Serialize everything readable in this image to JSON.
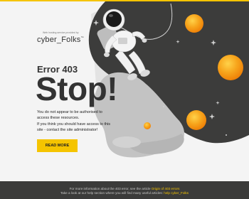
{
  "brand": {
    "tagline": "Web hosting service provided by",
    "name": "cyber_Folks",
    "trademark": "™"
  },
  "error": {
    "code_label": "Error 403",
    "headline": "Stop!",
    "message_line1": "You do not appear to be authorised to access these resources.",
    "message_line2": "If you think you should have access to this site - contact the site administrator!"
  },
  "actions": {
    "read_more_label": "READ MORE"
  },
  "footer": {
    "line1_text": "For more information about the 403 error, see the article",
    "line1_link": "Origin of 403 errors",
    "line2_text": "Take a look at our help section where you will find many useful articles:",
    "line2_link": "help cyber_Folks"
  },
  "colors": {
    "accent": "#f5c400",
    "text_dark": "#333333",
    "footer_bg": "#3b3b3a",
    "space_dark": "#3c3c3b",
    "cloud_grey": "#c3c3c3"
  }
}
